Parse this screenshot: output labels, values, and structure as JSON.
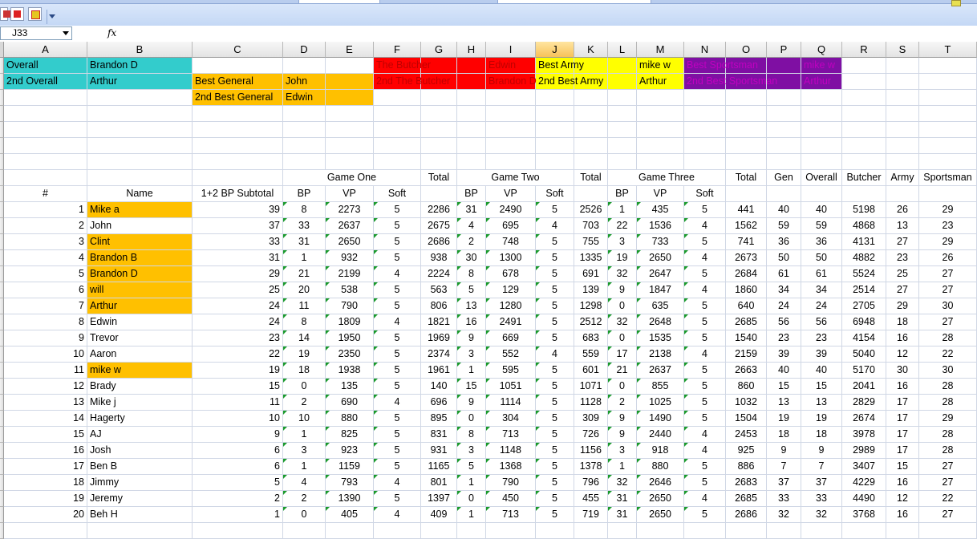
{
  "app": {
    "name_box": "J33",
    "formula_label": "fx",
    "selected_column": "J"
  },
  "columns": [
    "A",
    "B",
    "C",
    "D",
    "E",
    "F",
    "G",
    "H",
    "I",
    "J",
    "K",
    "L",
    "M",
    "N",
    "O",
    "P",
    "Q",
    "R",
    "S",
    "T"
  ],
  "colors": {
    "orange": "#ffc000",
    "cyan": "#33cccc",
    "red": "#ff0000",
    "yellow": "#ffff00",
    "purple": "#7f0fa3",
    "award_text_on_red": "#c00000",
    "award_text_on_purple": "#c000c0",
    "comment_marker": "#1a9a2c"
  },
  "awards": {
    "overall": {
      "label": "Overall",
      "winner": "Brandon D"
    },
    "overall_2nd": {
      "label": "2nd Overall",
      "winner": "Arthur"
    },
    "general": {
      "label": "Best General",
      "winner": "John"
    },
    "general_2nd": {
      "label": "2nd Best General",
      "winner": "Edwin"
    },
    "butcher": {
      "label": "The Butcher",
      "winner": "Edwin"
    },
    "butcher_2nd": {
      "label": "2nd The Butcher",
      "winner": "Brandon D"
    },
    "army": {
      "label": "Best Army",
      "winner": "mike w"
    },
    "army_2nd": {
      "label": "2nd Best Army",
      "winner": "Arthur"
    },
    "sportsman": {
      "label": "Best Sportsman",
      "winner": "mike w"
    },
    "sportsman_2nd": {
      "label": "2nd Best Sportsman",
      "winner": "Arthur"
    }
  },
  "headers": {
    "game_one": "Game One",
    "game_two": "Game Two",
    "game_three": "Game Three",
    "total": "Total",
    "gen": "Gen",
    "overall": "Overall",
    "butcher": "Butcher",
    "army": "Army",
    "sportsman": "Sportsman",
    "num": "#",
    "name": "Name",
    "subtotal": "1+2 BP Subtotal",
    "bp": "BP",
    "vp": "VP",
    "soft": "Soft"
  },
  "players": [
    {
      "num": "1",
      "name": "Mike a",
      "hl": true,
      "sub": "39",
      "g1": [
        "8",
        "2273",
        "5"
      ],
      "t1": "2286",
      "g2": [
        "31",
        "2490",
        "5"
      ],
      "t2": "2526",
      "g3": [
        "1",
        "435",
        "5"
      ],
      "t3": "441",
      "gen": "40",
      "overall": "40",
      "butcher": "5198",
      "army": "26",
      "sports": "29"
    },
    {
      "num": "2",
      "name": "John",
      "hl": false,
      "sub": "37",
      "g1": [
        "33",
        "2637",
        "5"
      ],
      "t1": "2675",
      "g2": [
        "4",
        "695",
        "4"
      ],
      "t2": "703",
      "g3": [
        "22",
        "1536",
        "4"
      ],
      "t3": "1562",
      "gen": "59",
      "overall": "59",
      "butcher": "4868",
      "army": "13",
      "sports": "23"
    },
    {
      "num": "3",
      "name": "Clint",
      "hl": true,
      "sub": "33",
      "g1": [
        "31",
        "2650",
        "5"
      ],
      "t1": "2686",
      "g2": [
        "2",
        "748",
        "5"
      ],
      "t2": "755",
      "g3": [
        "3",
        "733",
        "5"
      ],
      "t3": "741",
      "gen": "36",
      "overall": "36",
      "butcher": "4131",
      "army": "27",
      "sports": "29"
    },
    {
      "num": "4",
      "name": "Brandon B",
      "hl": true,
      "sub": "31",
      "g1": [
        "1",
        "932",
        "5"
      ],
      "t1": "938",
      "g2": [
        "30",
        "1300",
        "5"
      ],
      "t2": "1335",
      "g3": [
        "19",
        "2650",
        "4"
      ],
      "t3": "2673",
      "gen": "50",
      "overall": "50",
      "butcher": "4882",
      "army": "23",
      "sports": "26"
    },
    {
      "num": "5",
      "name": "Brandon D",
      "hl": true,
      "sub": "29",
      "g1": [
        "21",
        "2199",
        "4"
      ],
      "t1": "2224",
      "g2": [
        "8",
        "678",
        "5"
      ],
      "t2": "691",
      "g3": [
        "32",
        "2647",
        "5"
      ],
      "t3": "2684",
      "gen": "61",
      "overall": "61",
      "butcher": "5524",
      "army": "25",
      "sports": "27"
    },
    {
      "num": "6",
      "name": "will",
      "hl": true,
      "sub": "25",
      "g1": [
        "20",
        "538",
        "5"
      ],
      "t1": "563",
      "g2": [
        "5",
        "129",
        "5"
      ],
      "t2": "139",
      "g3": [
        "9",
        "1847",
        "4"
      ],
      "t3": "1860",
      "gen": "34",
      "overall": "34",
      "butcher": "2514",
      "army": "27",
      "sports": "27"
    },
    {
      "num": "7",
      "name": "Arthur",
      "hl": true,
      "sub": "24",
      "g1": [
        "11",
        "790",
        "5"
      ],
      "t1": "806",
      "g2": [
        "13",
        "1280",
        "5"
      ],
      "t2": "1298",
      "g3": [
        "0",
        "635",
        "5"
      ],
      "t3": "640",
      "gen": "24",
      "overall": "24",
      "butcher": "2705",
      "army": "29",
      "sports": "30"
    },
    {
      "num": "8",
      "name": "Edwin",
      "hl": false,
      "sub": "24",
      "g1": [
        "8",
        "1809",
        "4"
      ],
      "t1": "1821",
      "g2": [
        "16",
        "2491",
        "5"
      ],
      "t2": "2512",
      "g3": [
        "32",
        "2648",
        "5"
      ],
      "t3": "2685",
      "gen": "56",
      "overall": "56",
      "butcher": "6948",
      "army": "18",
      "sports": "27"
    },
    {
      "num": "9",
      "name": "Trevor",
      "hl": false,
      "sub": "23",
      "g1": [
        "14",
        "1950",
        "5"
      ],
      "t1": "1969",
      "g2": [
        "9",
        "669",
        "5"
      ],
      "t2": "683",
      "g3": [
        "0",
        "1535",
        "5"
      ],
      "t3": "1540",
      "gen": "23",
      "overall": "23",
      "butcher": "4154",
      "army": "16",
      "sports": "28"
    },
    {
      "num": "10",
      "name": "Aaron",
      "hl": false,
      "sub": "22",
      "g1": [
        "19",
        "2350",
        "5"
      ],
      "t1": "2374",
      "g2": [
        "3",
        "552",
        "4"
      ],
      "t2": "559",
      "g3": [
        "17",
        "2138",
        "4"
      ],
      "t3": "2159",
      "gen": "39",
      "overall": "39",
      "butcher": "5040",
      "army": "12",
      "sports": "22"
    },
    {
      "num": "11",
      "name": "mike w",
      "hl": true,
      "sub": "19",
      "g1": [
        "18",
        "1938",
        "5"
      ],
      "t1": "1961",
      "g2": [
        "1",
        "595",
        "5"
      ],
      "t2": "601",
      "g3": [
        "21",
        "2637",
        "5"
      ],
      "t3": "2663",
      "gen": "40",
      "overall": "40",
      "butcher": "5170",
      "army": "30",
      "sports": "30"
    },
    {
      "num": "12",
      "name": "Brady",
      "hl": false,
      "sub": "15",
      "g1": [
        "0",
        "135",
        "5"
      ],
      "t1": "140",
      "g2": [
        "15",
        "1051",
        "5"
      ],
      "t2": "1071",
      "g3": [
        "0",
        "855",
        "5"
      ],
      "t3": "860",
      "gen": "15",
      "overall": "15",
      "butcher": "2041",
      "army": "16",
      "sports": "28"
    },
    {
      "num": "13",
      "name": "Mike j",
      "hl": false,
      "sub": "11",
      "g1": [
        "2",
        "690",
        "4"
      ],
      "t1": "696",
      "g2": [
        "9",
        "1114",
        "5"
      ],
      "t2": "1128",
      "g3": [
        "2",
        "1025",
        "5"
      ],
      "t3": "1032",
      "gen": "13",
      "overall": "13",
      "butcher": "2829",
      "army": "17",
      "sports": "28"
    },
    {
      "num": "14",
      "name": "Hagerty",
      "hl": false,
      "sub": "10",
      "g1": [
        "10",
        "880",
        "5"
      ],
      "t1": "895",
      "g2": [
        "0",
        "304",
        "5"
      ],
      "t2": "309",
      "g3": [
        "9",
        "1490",
        "5"
      ],
      "t3": "1504",
      "gen": "19",
      "overall": "19",
      "butcher": "2674",
      "army": "17",
      "sports": "29"
    },
    {
      "num": "15",
      "name": "AJ",
      "hl": false,
      "sub": "9",
      "g1": [
        "1",
        "825",
        "5"
      ],
      "t1": "831",
      "g2": [
        "8",
        "713",
        "5"
      ],
      "t2": "726",
      "g3": [
        "9",
        "2440",
        "4"
      ],
      "t3": "2453",
      "gen": "18",
      "overall": "18",
      "butcher": "3978",
      "army": "17",
      "sports": "28"
    },
    {
      "num": "16",
      "name": "Josh",
      "hl": false,
      "sub": "6",
      "g1": [
        "3",
        "923",
        "5"
      ],
      "t1": "931",
      "g2": [
        "3",
        "1148",
        "5"
      ],
      "t2": "1156",
      "g3": [
        "3",
        "918",
        "4"
      ],
      "t3": "925",
      "gen": "9",
      "overall": "9",
      "butcher": "2989",
      "army": "17",
      "sports": "28"
    },
    {
      "num": "17",
      "name": "Ben B",
      "hl": false,
      "sub": "6",
      "g1": [
        "1",
        "1159",
        "5"
      ],
      "t1": "1165",
      "g2": [
        "5",
        "1368",
        "5"
      ],
      "t2": "1378",
      "g3": [
        "1",
        "880",
        "5"
      ],
      "t3": "886",
      "gen": "7",
      "overall": "7",
      "butcher": "3407",
      "army": "15",
      "sports": "27"
    },
    {
      "num": "18",
      "name": "Jimmy",
      "hl": false,
      "sub": "5",
      "g1": [
        "4",
        "793",
        "4"
      ],
      "t1": "801",
      "g2": [
        "1",
        "790",
        "5"
      ],
      "t2": "796",
      "g3": [
        "32",
        "2646",
        "5"
      ],
      "t3": "2683",
      "gen": "37",
      "overall": "37",
      "butcher": "4229",
      "army": "16",
      "sports": "27"
    },
    {
      "num": "19",
      "name": "Jeremy",
      "hl": false,
      "sub": "2",
      "g1": [
        "2",
        "1390",
        "5"
      ],
      "t1": "1397",
      "g2": [
        "0",
        "450",
        "5"
      ],
      "t2": "455",
      "g3": [
        "31",
        "2650",
        "4"
      ],
      "t3": "2685",
      "gen": "33",
      "overall": "33",
      "butcher": "4490",
      "army": "12",
      "sports": "22"
    },
    {
      "num": "20",
      "name": "Beh H",
      "hl": false,
      "sub": "1",
      "g1": [
        "0",
        "405",
        "4"
      ],
      "t1": "409",
      "g2": [
        "1",
        "713",
        "5"
      ],
      "t2": "719",
      "g3": [
        "31",
        "2650",
        "5"
      ],
      "t3": "2686",
      "gen": "32",
      "overall": "32",
      "butcher": "3768",
      "army": "16",
      "sports": "27"
    }
  ]
}
